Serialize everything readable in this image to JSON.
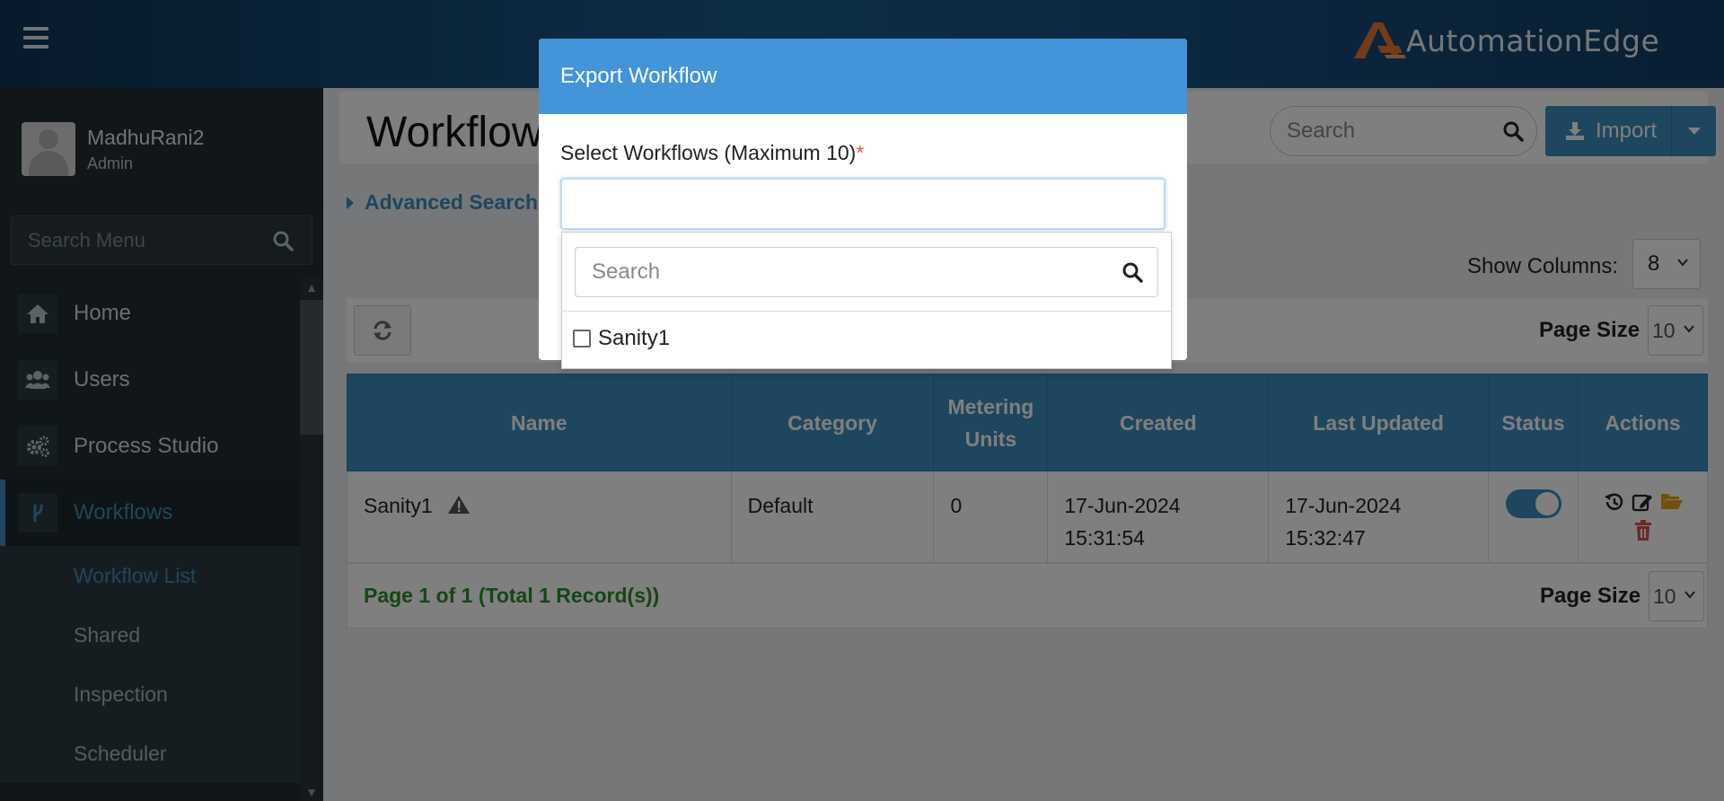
{
  "header": {
    "brand": "AutomationEdge"
  },
  "sidebar": {
    "user": {
      "name": "MadhuRani2",
      "role": "Admin"
    },
    "search_placeholder": "Search Menu",
    "items": [
      {
        "label": "Home",
        "icon": "home-icon"
      },
      {
        "label": "Users",
        "icon": "users-icon"
      },
      {
        "label": "Process Studio",
        "icon": "cogs-icon"
      },
      {
        "label": "Workflows",
        "icon": "workflow-icon",
        "active": true
      }
    ],
    "subitems": [
      {
        "label": "Workflow List",
        "active": true
      },
      {
        "label": "Shared"
      },
      {
        "label": "Inspection"
      },
      {
        "label": "Scheduler"
      }
    ]
  },
  "page": {
    "title": "Workflows",
    "search_placeholder": "Search",
    "import_label": "Import",
    "advanced_search": "Advanced Search",
    "show_columns_label": "Show Columns:",
    "show_columns_value": "8",
    "page_size_label": "Page Size",
    "page_size_value": "10",
    "page_info": "Page 1 of 1 (Total 1 Record(s))"
  },
  "table": {
    "columns": [
      "Name",
      "Category",
      "Metering Units",
      "Created",
      "Last Updated",
      "Status",
      "Actions"
    ],
    "rows": [
      {
        "name": "Sanity1",
        "category": "Default",
        "metering_units": "0",
        "created_date": "17-Jun-2024",
        "created_time": "15:31:54",
        "updated_date": "17-Jun-2024",
        "updated_time": "15:32:47",
        "status_enabled": true
      }
    ]
  },
  "modal": {
    "title": "Export Workflow",
    "field_label": "Select Workflows (Maximum 10)",
    "required_mark": "*",
    "dropdown_search_placeholder": "Search",
    "options": [
      {
        "label": "Sanity1",
        "checked": false
      }
    ]
  },
  "colors": {
    "primary": "#3c8dbc",
    "modal_header": "#4394d8",
    "sidebar": "#222d32",
    "success": "#2e8b2e",
    "danger": "#d9534f",
    "warning": "#e6a117"
  }
}
